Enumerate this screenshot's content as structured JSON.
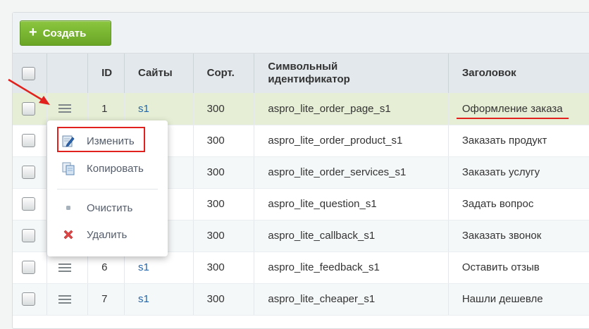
{
  "toolbar": {
    "create_label": "Создать"
  },
  "table": {
    "headers": {
      "id": "ID",
      "sites": "Сайты",
      "sort": "Сорт.",
      "code_line1": "Символьный",
      "code_line2": "идентификатор",
      "title": "Заголовок"
    },
    "rows": [
      {
        "id": "1",
        "site": "s1",
        "sort": "300",
        "code": "aspro_lite_order_page_s1",
        "title": "Оформление заказа"
      },
      {
        "id": "",
        "site": "",
        "sort": "300",
        "code": "aspro_lite_order_product_s1",
        "title": "Заказать продукт"
      },
      {
        "id": "",
        "site": "",
        "sort": "300",
        "code": "aspro_lite_order_services_s1",
        "title": "Заказать услугу"
      },
      {
        "id": "",
        "site": "",
        "sort": "300",
        "code": "aspro_lite_question_s1",
        "title": "Задать вопрос"
      },
      {
        "id": "",
        "site": "",
        "sort": "300",
        "code": "aspro_lite_callback_s1",
        "title": "Заказать звонок"
      },
      {
        "id": "6",
        "site": "s1",
        "sort": "300",
        "code": "aspro_lite_feedback_s1",
        "title": "Оставить отзыв"
      },
      {
        "id": "7",
        "site": "s1",
        "sort": "300",
        "code": "aspro_lite_cheaper_s1",
        "title": "Нашли дешевле"
      }
    ]
  },
  "context_menu": {
    "edit": "Изменить",
    "copy": "Копировать",
    "clear": "Очистить",
    "delete": "Удалить"
  },
  "colors": {
    "accent_green": "#7ab833",
    "selected_row": "#e6eed5",
    "annotation_red": "#e0211d",
    "link_blue": "#2067b0"
  },
  "icons": {
    "create": "plus-icon",
    "row_menu": "menu-icon",
    "edit": "pencil-icon",
    "copy": "copy-icon",
    "clear": "dot-icon",
    "delete": "cross-icon"
  }
}
